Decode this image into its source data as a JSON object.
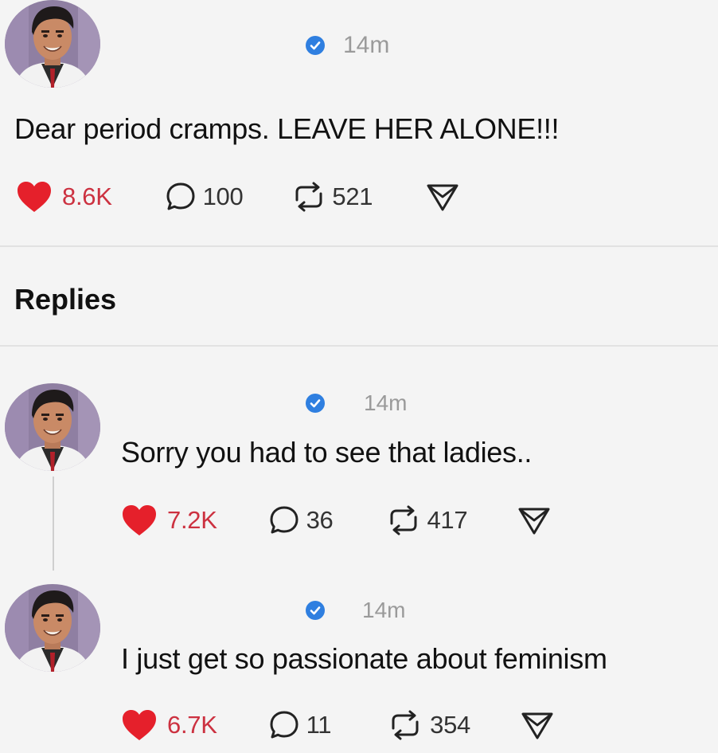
{
  "main_post": {
    "time": "14m",
    "text": "Dear period cramps. LEAVE HER ALONE!!!",
    "likes": "8.6K",
    "replies": "100",
    "reposts": "521"
  },
  "replies_heading": "Replies",
  "replies": [
    {
      "time": "14m",
      "text": "Sorry you had to see that ladies..",
      "likes": "7.2K",
      "replies": "36",
      "reposts": "417"
    },
    {
      "time": "14m",
      "text": "I just get so passionate about feminism",
      "likes": "6.7K",
      "replies": "11",
      "reposts": "354"
    }
  ],
  "colors": {
    "like": "#cc3140",
    "verified": "#2f7fe0",
    "meta": "#9a9a9a",
    "background": "#f4f4f4"
  },
  "icons": [
    "avatar",
    "verified-badge-icon",
    "heart-icon",
    "comment-icon",
    "repost-icon",
    "share-icon"
  ]
}
